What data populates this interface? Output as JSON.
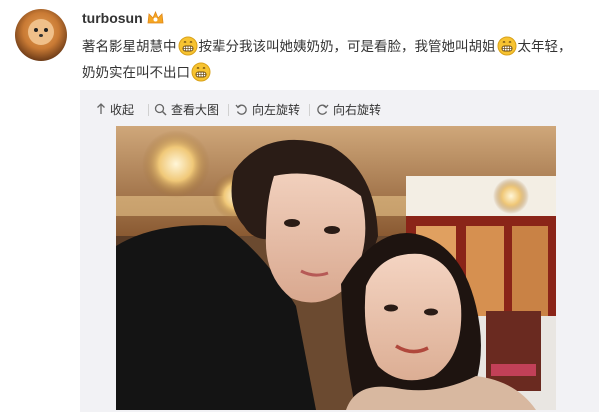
{
  "post": {
    "username": "turbosun",
    "text_segments": [
      "著名影星胡慧中",
      "按辈分我该叫她姨奶奶，可是看脸，我管她叫胡姐",
      "太年轻，",
      "奶奶实在叫不出口"
    ],
    "emoji_name": "grin-emoji"
  },
  "toolbar": {
    "collapse_label": "收起",
    "view_large_label": "查看大图",
    "rotate_left_label": "向左旋转",
    "rotate_right_label": "向右旋转"
  },
  "icons": {
    "collapse": "arrow-up-icon",
    "view_large": "magnifier-icon",
    "rotate_left": "rotate-left-icon",
    "rotate_right": "rotate-right-icon",
    "badge": "vip-crown-icon"
  },
  "colors": {
    "badge": "#f5a623",
    "emoji": "#f7c331",
    "toolbar_bg": "#f2f2f5"
  }
}
